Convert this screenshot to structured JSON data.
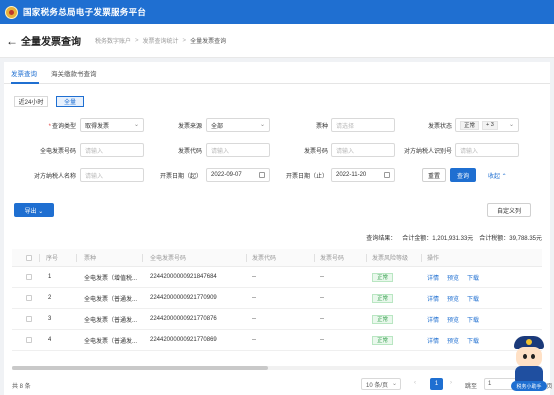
{
  "site": {
    "title": "国家税务总局电子发票服务平台"
  },
  "header": {
    "back_icon": "arrow-left-icon",
    "title": "全量发票查询",
    "breadcrumb": [
      "税务数字账户",
      "发票查询统计",
      "全量发票查询"
    ]
  },
  "tabs": [
    {
      "label": "发票查询",
      "active": true
    },
    {
      "label": "海关缴款书查询",
      "active": false
    }
  ],
  "range": {
    "opt1": "近24小时",
    "opt2": "全量",
    "selected": "全量"
  },
  "form": {
    "query_type": {
      "label": "查询类型",
      "value": "取得发票"
    },
    "source": {
      "label": "发票来源",
      "value": "全部"
    },
    "kind": {
      "label": "票种",
      "placeholder": "请选择"
    },
    "status": {
      "label": "发票状态",
      "tag": "正常",
      "more": "+ 3"
    },
    "full_no": {
      "label": "全电发票号码",
      "placeholder": "请输入"
    },
    "code": {
      "label": "发票代码",
      "placeholder": "请输入"
    },
    "number": {
      "label": "发票号码",
      "placeholder": "请输入"
    },
    "tax_id": {
      "label": "对方纳税人识别号",
      "placeholder": "请输入"
    },
    "party_name": {
      "label": "对方纳税人名称",
      "placeholder": "请输入"
    },
    "date_from": {
      "label": "开票日期（起）",
      "value": "2022-09-07"
    },
    "date_to": {
      "label": "开票日期（止）",
      "value": "2022-11-20"
    },
    "reset_label": "重置",
    "search_label": "查询",
    "collapse_label": "收起 ⌃"
  },
  "toolbar": {
    "export_label": "导出 ⌄",
    "custom_columns_label": "自定义列"
  },
  "summary": {
    "title": "查询结果：",
    "amount": "合计金额：1,201,931.33元",
    "tax": "合计税额：39,788.35元"
  },
  "table": {
    "columns": [
      "序号",
      "票种",
      "全电发票号码",
      "发票代码",
      "发票号码",
      "发票风险等级",
      "操作"
    ],
    "rows": [
      {
        "idx": "1",
        "kind": "全电发票（增值税...",
        "full_no": "22442000000921847684",
        "code": "--",
        "number": "--",
        "risk": "正常"
      },
      {
        "idx": "2",
        "kind": "全电发票（普通发...",
        "full_no": "22442000000921770909",
        "code": "--",
        "number": "--",
        "risk": "正常"
      },
      {
        "idx": "3",
        "kind": "全电发票（普通发...",
        "full_no": "22442000000921770876",
        "code": "--",
        "number": "--",
        "risk": "正常"
      },
      {
        "idx": "4",
        "kind": "全电发票（普通发...",
        "full_no": "22442000000921770869",
        "code": "--",
        "number": "--",
        "risk": "正常"
      }
    ],
    "actions": [
      "详情",
      "预览",
      "下载"
    ]
  },
  "pagination": {
    "total": "共 8 条",
    "page_size": "10 条/页",
    "current": "1",
    "goto_label": "跳至",
    "goto_value": "1",
    "of": "/ 1 页"
  },
  "mascot": {
    "label": "税务小助手"
  },
  "colors": {
    "brand": "#1f6fd1",
    "success": "#37a04f",
    "required": "#e03b3b"
  }
}
